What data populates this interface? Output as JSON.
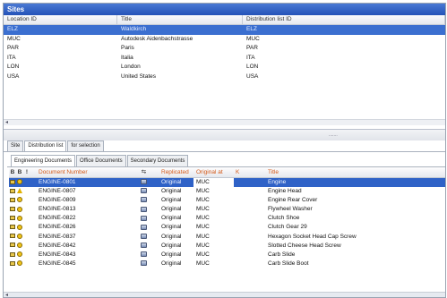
{
  "window": {
    "title": "Sites"
  },
  "sites_grid": {
    "columns": [
      "Location ID",
      "Title",
      "Distribution list ID"
    ],
    "rows": [
      [
        "ELZ",
        "Waldkirch",
        "ELZ"
      ],
      [
        "MUC",
        "Autodesk Aidenbachstrasse",
        "MUC"
      ],
      [
        "PAR",
        "Paris",
        "PAR"
      ],
      [
        "ITA",
        "Italia",
        "ITA"
      ],
      [
        "LON",
        "London",
        "LON"
      ],
      [
        "USA",
        "United States",
        "USA"
      ]
    ],
    "selected_index": 0
  },
  "splitter": {
    "grip": "......."
  },
  "tabs_level1": [
    "Site",
    "Distribution list",
    "for selection"
  ],
  "tabs_level2": [
    "Engineering Documents",
    "Office Documents",
    "Secondary Documents"
  ],
  "doc_grid": {
    "header_icons": [
      "B",
      "B",
      "!"
    ],
    "columns": {
      "number": "Document Number",
      "published": "⇆",
      "released": "Replicated",
      "holder": "Original at",
      "marker": "K",
      "title": "Title"
    },
    "rows": [
      {
        "number": "ENGINE-0801",
        "release": "Original",
        "holder": "MUC",
        "title": "Engine",
        "icon2": "circle"
      },
      {
        "number": "ENGINE-0807",
        "release": "Original",
        "holder": "MUC",
        "title": "Engine Head",
        "icon2": "warning"
      },
      {
        "number": "ENGINE-0809",
        "release": "Original",
        "holder": "MUC",
        "title": "Engine Rear Cover",
        "icon2": "circle"
      },
      {
        "number": "ENGINE-0813",
        "release": "Original",
        "holder": "MUC",
        "title": "Flywheel Washer",
        "icon2": "circle"
      },
      {
        "number": "ENGINE-0822",
        "release": "Original",
        "holder": "MUC",
        "title": "Clutch Shoe",
        "icon2": "circle"
      },
      {
        "number": "ENGINE-0826",
        "release": "Original",
        "holder": "MUC",
        "title": "Clutch Gear 29",
        "icon2": "circle"
      },
      {
        "number": "ENGINE-0837",
        "release": "Original",
        "holder": "MUC",
        "title": "Hexagon Socket Head Cap Screw",
        "icon2": "circle"
      },
      {
        "number": "ENGINE-0842",
        "release": "Original",
        "holder": "MUC",
        "title": "Slotted Cheese Head Screw",
        "icon2": "circle"
      },
      {
        "number": "ENGINE-0843",
        "release": "Original",
        "holder": "MUC",
        "title": "Carb Slide",
        "icon2": "circle"
      },
      {
        "number": "ENGINE-0845",
        "release": "Original",
        "holder": "MUC",
        "title": "Carb Slide Boot",
        "icon2": "circle"
      }
    ],
    "selected_index": 0
  },
  "colors": {
    "selection": "#2f62c7",
    "title_bar": "#2452b8",
    "header_text": "#d35a1a"
  }
}
